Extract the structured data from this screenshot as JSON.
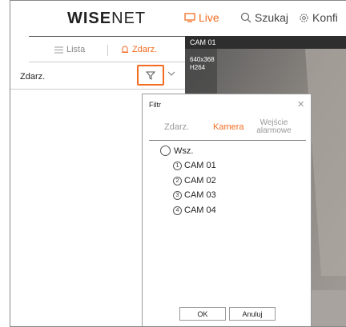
{
  "header": {
    "logo_bold": "WΙSE",
    "logo_light": "NET",
    "nav": [
      {
        "label": "Live",
        "icon": "monitor-icon",
        "active": true
      },
      {
        "label": "Szukaj",
        "icon": "search-icon",
        "active": false
      },
      {
        "label": "Konfi",
        "icon": "gear-icon",
        "active": false
      }
    ]
  },
  "left_panel": {
    "tabs": [
      {
        "label": "Lista",
        "icon": "list-icon"
      },
      {
        "label": "Zdarz.",
        "icon": "bell-icon"
      }
    ],
    "filter_row_label": "Zdarz."
  },
  "camera": {
    "name": "CAM 01",
    "resolution": "640x368",
    "codec": "H264"
  },
  "dialog": {
    "title": "Filtr",
    "tabs": {
      "zdarz": "Zdarz.",
      "kamera": "Kamera",
      "wejscie_line1": "Wejście",
      "wejscie_line2": "alarmowe"
    },
    "all_label": "Wsz.",
    "cameras": [
      {
        "num": "1",
        "label": "CAM 01"
      },
      {
        "num": "2",
        "label": "CAM 02"
      },
      {
        "num": "3",
        "label": "CAM 03"
      },
      {
        "num": "4",
        "label": "CAM 04"
      }
    ],
    "ok_label": "OK",
    "cancel_label": "Anuluj"
  },
  "colors": {
    "accent": "#f36c21",
    "header_text": "#444444"
  }
}
